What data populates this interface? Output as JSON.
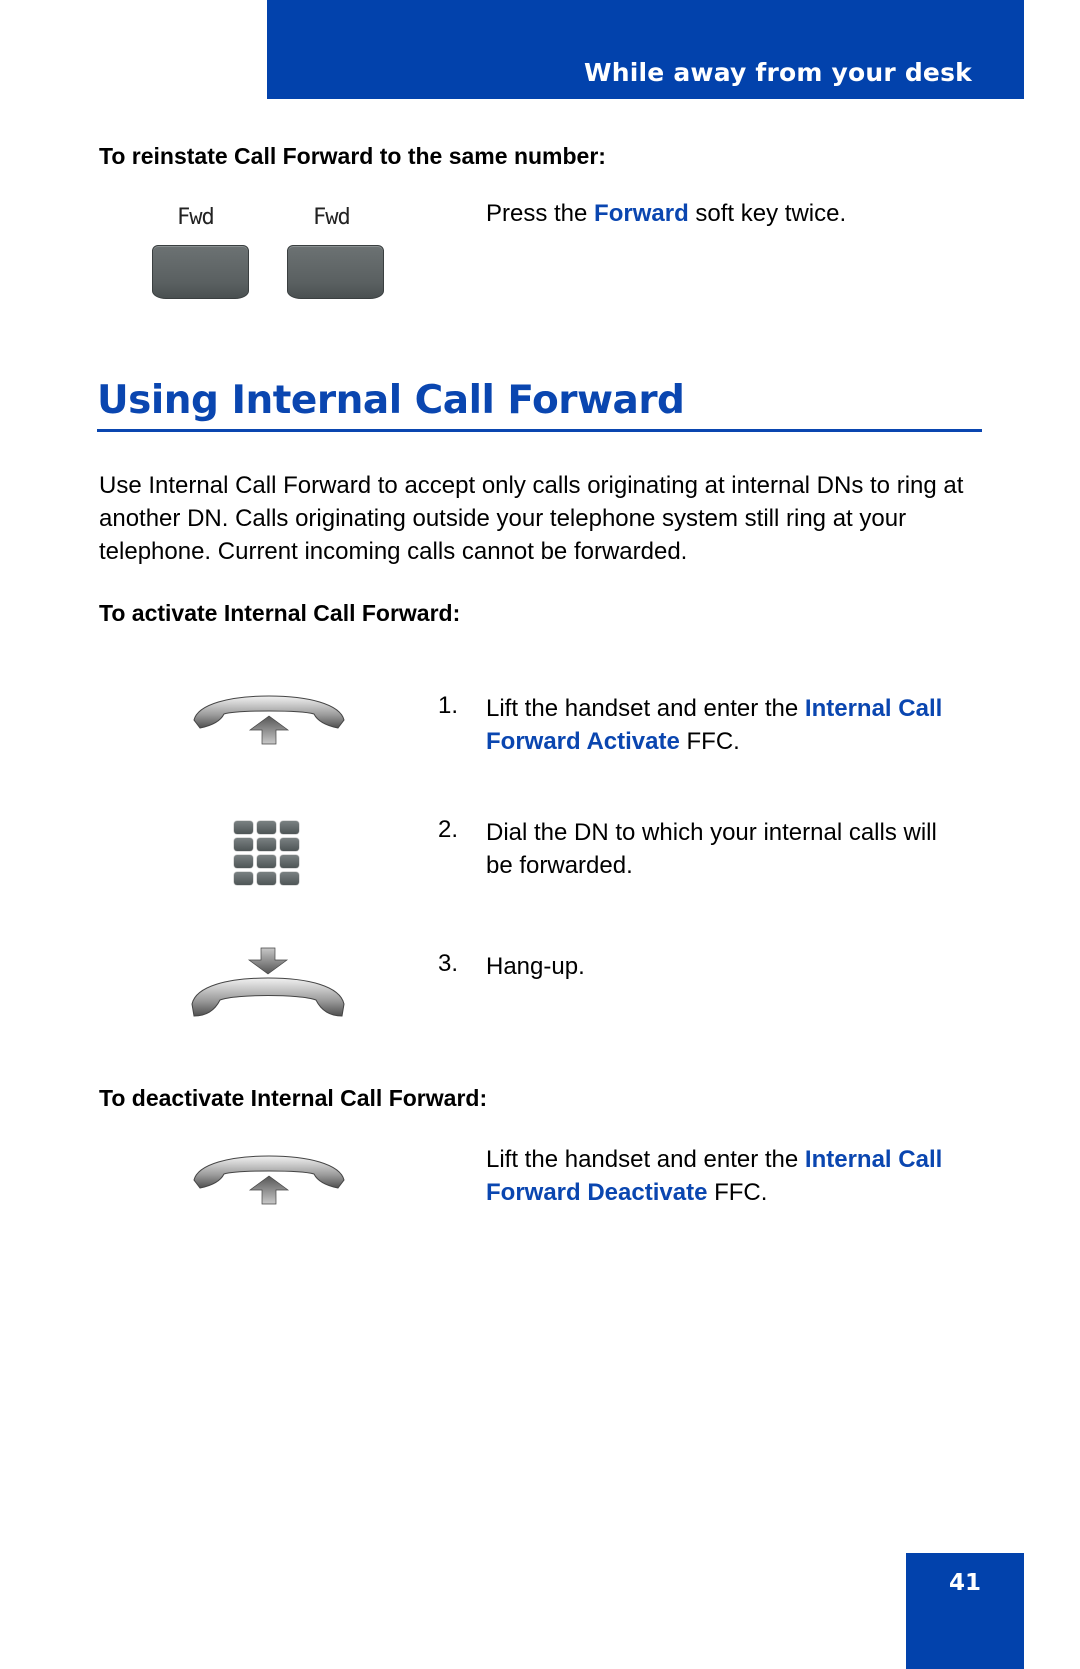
{
  "header": {
    "section_title": "While away from your desk"
  },
  "reinstate": {
    "heading": "To reinstate Call Forward to the same number:",
    "softkeys": [
      {
        "label": "Fwd"
      },
      {
        "label": "Fwd"
      }
    ],
    "instruction_pre": "Press the ",
    "instruction_key": "Forward",
    "instruction_post": " soft key twice."
  },
  "main": {
    "title": "Using Internal Call Forward",
    "intro": "Use Internal Call Forward to accept only calls originating at internal DNs to ring at another DN. Calls originating outside your telephone system still ring at your telephone. Current incoming calls cannot be forwarded."
  },
  "activate": {
    "heading": "To activate Internal Call Forward:",
    "steps": [
      {
        "num": "1.",
        "icon": "handset-lift-icon",
        "text_pre": "Lift the handset and enter the ",
        "text_key": "Internal Call Forward Activate",
        "text_post": " FFC."
      },
      {
        "num": "2.",
        "icon": "dialpad-icon",
        "text_pre": "Dial the DN to which your internal calls will be forwarded.",
        "text_key": "",
        "text_post": ""
      },
      {
        "num": "3.",
        "icon": "handset-hangup-icon",
        "text_pre": "Hang-up.",
        "text_key": "",
        "text_post": ""
      }
    ]
  },
  "deactivate": {
    "heading": "To deactivate Internal Call Forward:",
    "icon": "handset-lift-icon",
    "text_pre": "Lift the handset and enter the ",
    "text_key": "Internal Call Forward Deactivate",
    "text_post": " FFC."
  },
  "footer": {
    "page_number": "41"
  },
  "colors": {
    "brand_blue": "#0242ac",
    "link_blue": "#0a46b0"
  }
}
